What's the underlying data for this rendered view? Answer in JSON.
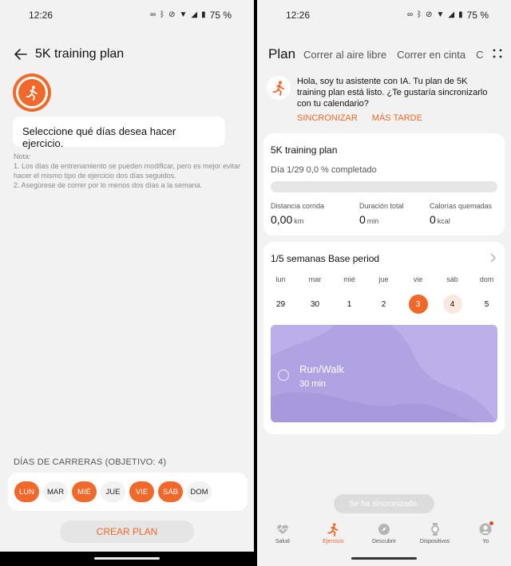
{
  "status_bar": {
    "time": "12:26",
    "battery": "75 %"
  },
  "left": {
    "title": "5K training plan",
    "prompt": "Seleccione qué días desea hacer ejercicio.",
    "nota_title": "Nota:",
    "nota_1": "1. Los días de entrenamiento se pueden modificar, pero es mejor evitar hacer el mismo tipo de ejercicio dos días seguidos.",
    "nota_2": "2. Asegúrese de correr por lo menos dos días a la semana.",
    "days_label": "DÍAS DE CARRERAS (OBJETIVO: 4)",
    "days": [
      {
        "label": "LUN",
        "selected": true
      },
      {
        "label": "MAR",
        "selected": false
      },
      {
        "label": "MIÉ",
        "selected": true
      },
      {
        "label": "JUE",
        "selected": false
      },
      {
        "label": "VIE",
        "selected": true
      },
      {
        "label": "SÁB",
        "selected": true
      },
      {
        "label": "DOM",
        "selected": false
      }
    ],
    "create_button": "CREAR PLAN"
  },
  "right": {
    "tabs": [
      "Plan",
      "Correr al aire libre",
      "Correr en cinta",
      "C"
    ],
    "ai_message": "Hola, soy tu asistente con IA. Tu plan de 5K training plan está listo. ¿Te gustaría sincronizarlo con tu calendario?",
    "sync_button": "SINCRONIZAR",
    "later_button": "MÁS TARDE",
    "plan": {
      "title": "5K training plan",
      "progress_text": "Día 1/29 0,0 % completado",
      "progress": 0.0,
      "stats": [
        {
          "label": "Distancia corrida",
          "value": "0,00",
          "unit": "km"
        },
        {
          "label": "Duración total",
          "value": "0",
          "unit": "min"
        },
        {
          "label": "Calorías quemadas",
          "value": "0",
          "unit": "kcal"
        }
      ]
    },
    "week": {
      "title": "1/5 semanas Base period",
      "days": [
        {
          "name": "lun",
          "num": "29"
        },
        {
          "name": "mar",
          "num": "30"
        },
        {
          "name": "mié",
          "num": "1"
        },
        {
          "name": "jue",
          "num": "2"
        },
        {
          "name": "vie",
          "num": "3"
        },
        {
          "name": "sáb",
          "num": "4"
        },
        {
          "name": "dom",
          "num": "5"
        }
      ],
      "workout_name": "Run/Walk",
      "workout_duration": "30 min"
    },
    "toast": "Se ha sincronizado.",
    "bottom_nav": [
      "Salud",
      "Ejercicio",
      "Descubrir",
      "Dispositivos",
      "Yo"
    ],
    "accent_color": "#f0692a",
    "workout_color": "#b1a2e3"
  }
}
